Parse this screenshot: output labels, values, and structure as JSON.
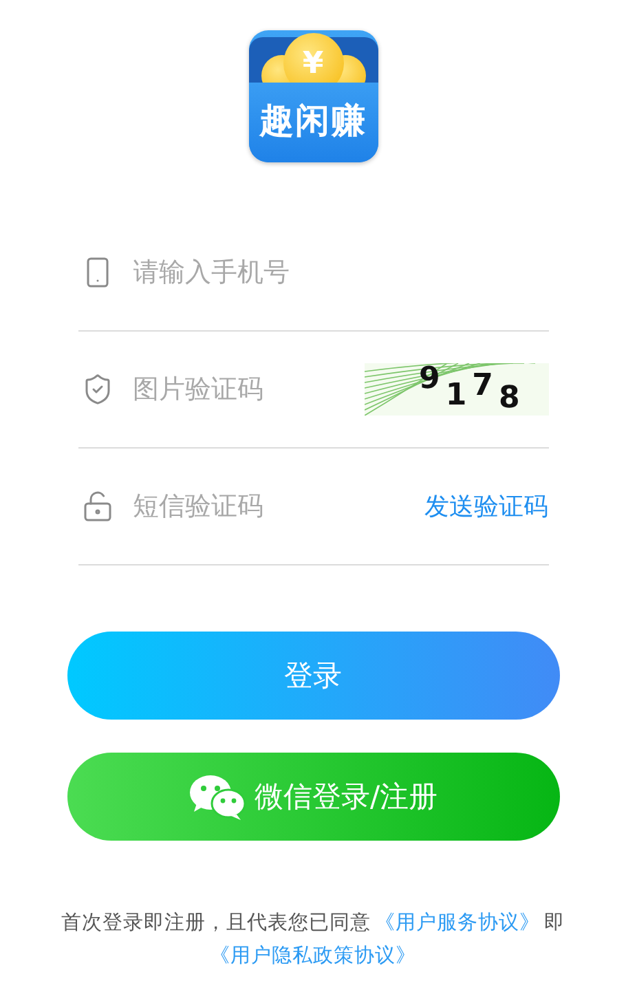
{
  "logo": {
    "text": "趣闲赚",
    "symbol": "¥"
  },
  "fields": [
    {
      "kind": "phone",
      "placeholder": "请输入手机号"
    },
    {
      "kind": "captcha",
      "placeholder": "图片验证码",
      "captcha": "9178"
    },
    {
      "kind": "sms",
      "placeholder": "短信验证码",
      "action": "发送验证码"
    }
  ],
  "buttons": [
    {
      "kind": "login",
      "label": "登录"
    },
    {
      "kind": "wechat",
      "label": "微信登录/注册"
    }
  ],
  "agreement": [
    {
      "kind": "text",
      "text": "首次登录即注册，且代表您已同意"
    },
    {
      "kind": "link",
      "text": "《用户服务协议》"
    },
    {
      "kind": "text",
      "text": "即"
    },
    {
      "kind": "link",
      "text": "《用户隐私政策协议》"
    }
  ]
}
